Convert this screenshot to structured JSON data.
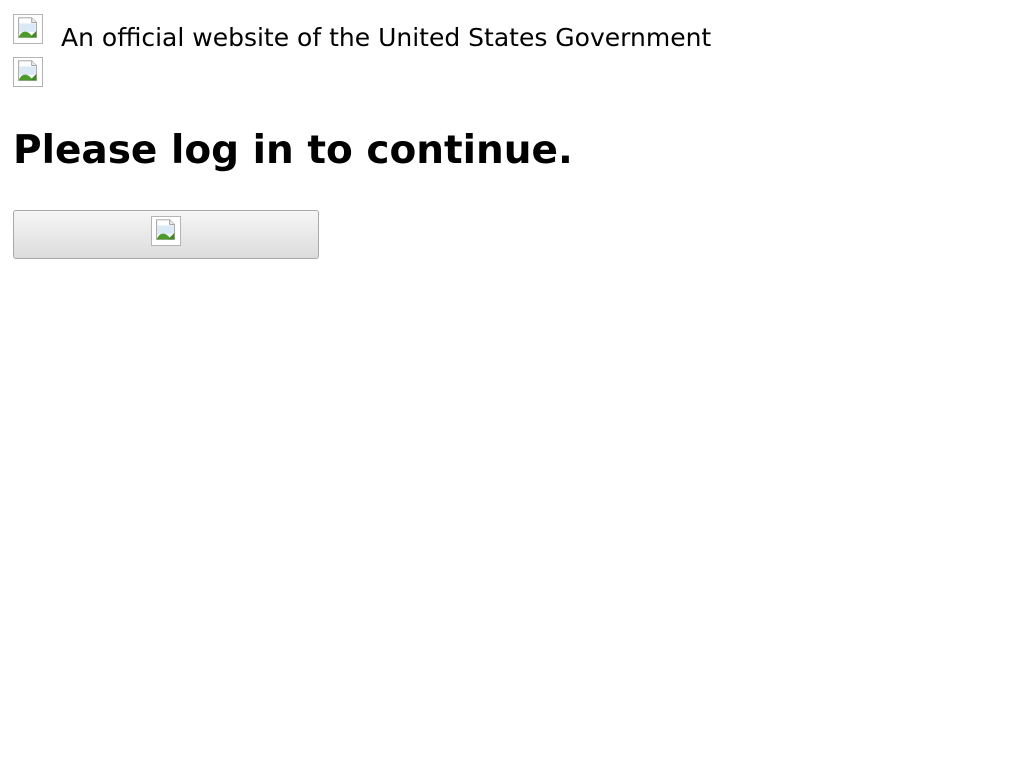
{
  "banner": {
    "flag_icon": "us-flag-image",
    "text": "An official website of the United States Government"
  },
  "header": {
    "logo_icon": "site-logo-image"
  },
  "main": {
    "heading": "Please log in to continue.",
    "login_button_icon": "login-button-image"
  }
}
